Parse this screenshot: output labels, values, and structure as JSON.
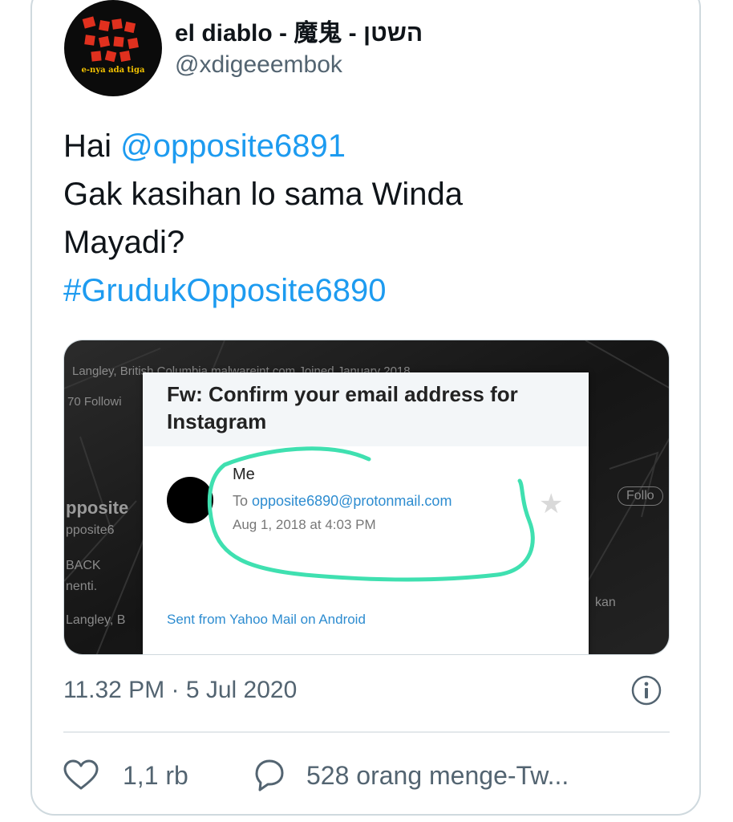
{
  "tweet": {
    "author": {
      "display_name": "el diablo - 魔鬼 - השטן",
      "handle": "@xdigeeembok",
      "avatar_tagline": "e-nya ada tiga"
    },
    "text": {
      "greeting": "Hai ",
      "mention": "@opposite6891",
      "line2": "Gak kasihan lo sama Winda",
      "line3": "Mayadi?",
      "hashtag": "#GrudukOpposite6890"
    },
    "timestamp": "11.32 PM · 5 Jul 2020",
    "stats": {
      "likes": "1,1 rb",
      "retweets": "528 orang menge-Tw..."
    }
  },
  "media": {
    "background_text": {
      "top_row": "Langley, British Columbia   malwareint.com   Joined January 2018",
      "followers": "70 Followi",
      "profile_name": "pposite",
      "profile_handle": "pposite6",
      "back": "BACK",
      "menti": "nenti.",
      "langley": "Langley, B",
      "follow": "Follo",
      "kan": "kan"
    },
    "email": {
      "subject": "Fw: Confirm your email address for Instagram",
      "sender": "Me",
      "to_label": "To ",
      "to_address": "opposite6890@protonmail.com",
      "date": "Aug 1, 2018 at 4:03 PM",
      "signature": "Sent from Yahoo Mail on Android"
    }
  },
  "colors": {
    "link": "#1d9bf0",
    "secondary_text": "#536471",
    "highlight_circle": "#3fe0b0"
  },
  "icons": [
    "info-icon",
    "heart-icon",
    "reply-icon",
    "star-icon"
  ]
}
